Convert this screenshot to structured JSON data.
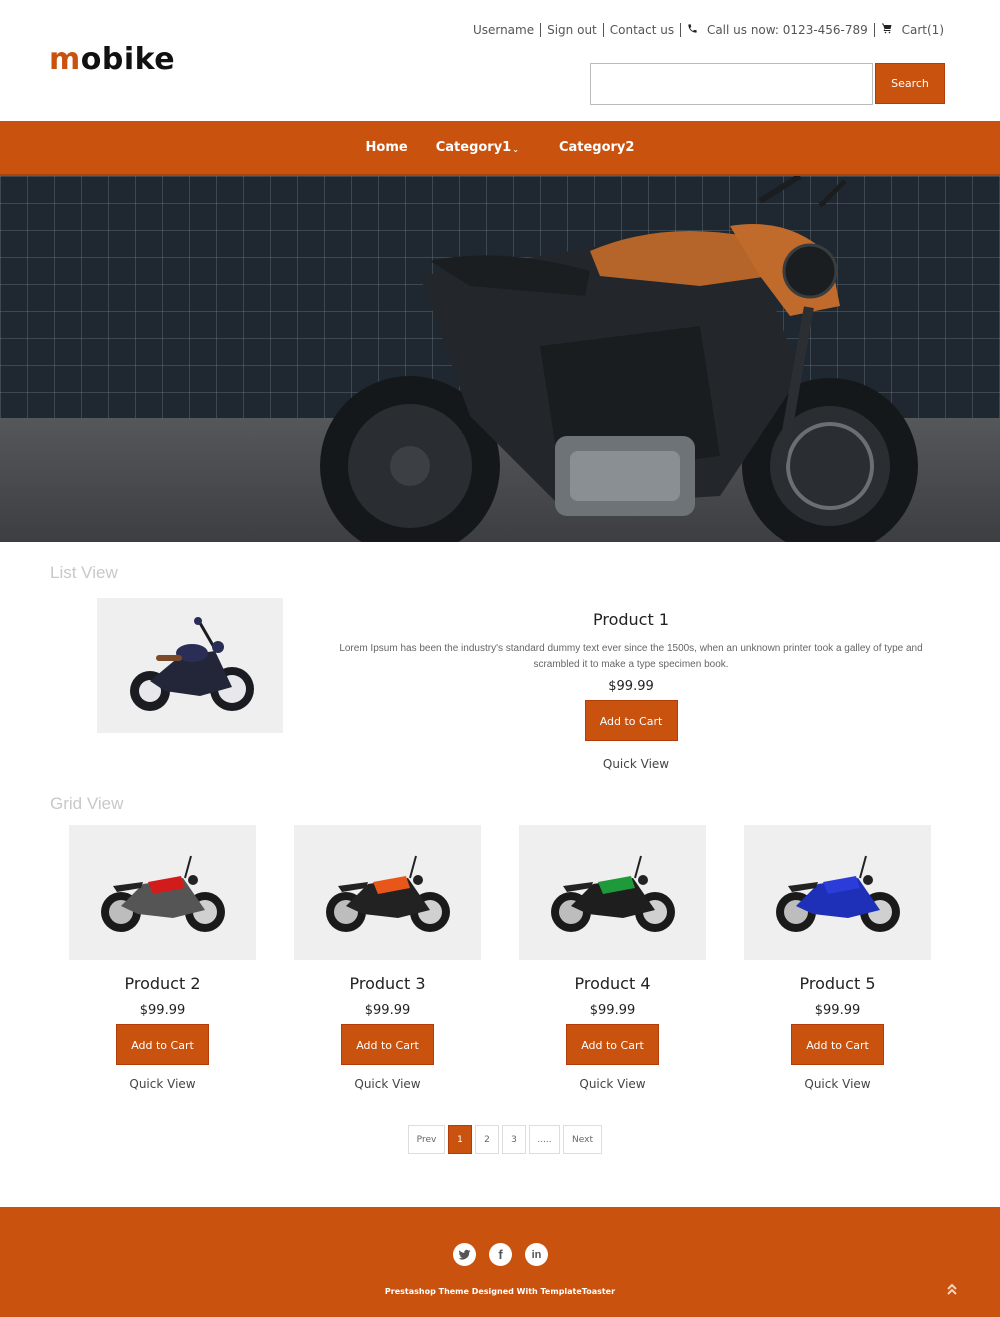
{
  "brand": {
    "logo_first": "m",
    "logo_rest": "obike",
    "accent_color": "#c9520f"
  },
  "top_links": {
    "username": "Username",
    "sign_out": "Sign out",
    "contact": "Contact us",
    "phone_icon": "phone-icon",
    "call": "Call us now: 0123-456-789",
    "cart_icon": "cart-icon",
    "cart": "Cart(1)"
  },
  "search": {
    "value": "",
    "placeholder": "",
    "button": "Search"
  },
  "nav": {
    "items": [
      {
        "label": "Home"
      },
      {
        "label": "Category1",
        "has_dropdown": true
      },
      {
        "label": "Category2"
      }
    ]
  },
  "hero": {
    "image": "motorcycle-banner"
  },
  "list_view": {
    "title": "List View",
    "product": {
      "name": "Product 1",
      "description": "Lorem Ipsum has been the industry's standard dummy text ever since the 1500s, when an unknown printer took a galley of type and scrambled it to make a type specimen book.",
      "price": "$99.99",
      "add_to_cart": "Add to Cart",
      "quick_view": "Quick View"
    }
  },
  "grid_view": {
    "title": "Grid View",
    "products": [
      {
        "name": "Product 2",
        "price": "$99.99",
        "add_to_cart": "Add to Cart",
        "quick_view": "Quick View",
        "bike_color": "#555555",
        "accent": "#d21c1c"
      },
      {
        "name": "Product 3",
        "price": "$99.99",
        "add_to_cart": "Add to Cart",
        "quick_view": "Quick View",
        "bike_color": "#222222",
        "accent": "#e8561a"
      },
      {
        "name": "Product 4",
        "price": "$99.99",
        "add_to_cart": "Add to Cart",
        "quick_view": "Quick View",
        "bike_color": "#1e1e1e",
        "accent": "#1f9a3a"
      },
      {
        "name": "Product 5",
        "price": "$99.99",
        "add_to_cart": "Add to Cart",
        "quick_view": "Quick View",
        "bike_color": "#1e2fb8",
        "accent": "#2b3cd8"
      }
    ]
  },
  "pagination": {
    "prev": "Prev",
    "pages": [
      "1",
      "2",
      "3"
    ],
    "ellipsis": ".....",
    "next": "Next",
    "current": "1"
  },
  "footer": {
    "social": [
      "twitter-icon",
      "facebook-icon",
      "linkedin-icon"
    ],
    "facebook_glyph": "f",
    "linkedin_glyph": "in",
    "credit": "Prestashop Theme Designed With TemplateToaster"
  }
}
